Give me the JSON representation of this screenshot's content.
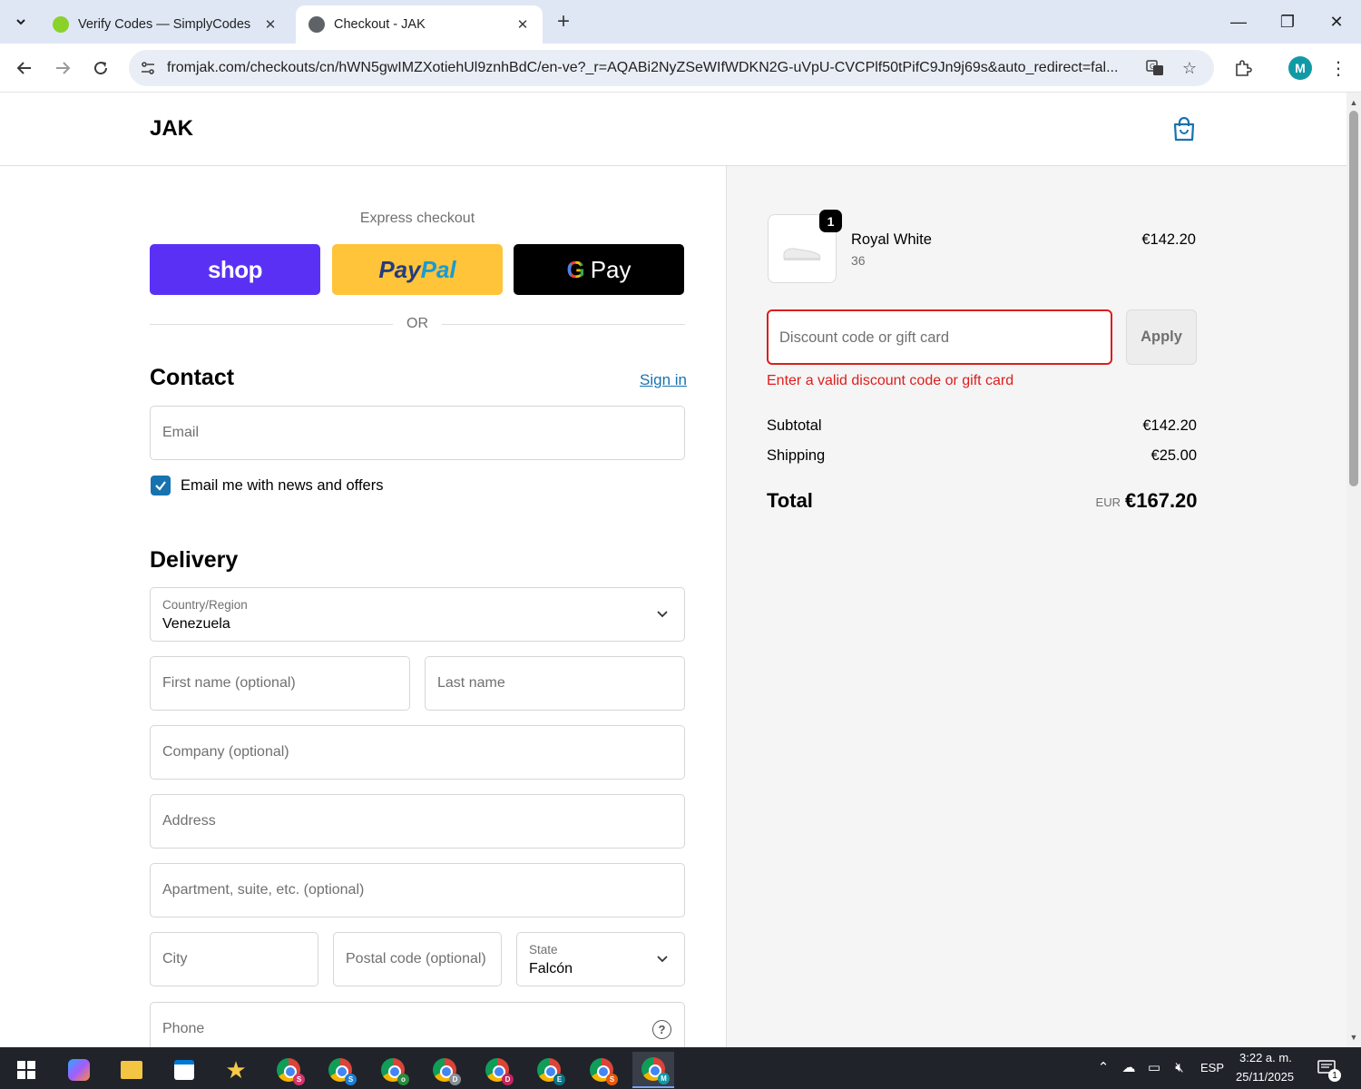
{
  "browser": {
    "tabs": [
      {
        "title": "Verify Codes — SimplyCodes",
        "active": false
      },
      {
        "title": "Checkout - JAK",
        "active": true
      }
    ],
    "url": "fromjak.com/checkouts/cn/hWN5gwIMZXotiehUl9znhBdC/en-ve?_r=AQABi2NyZSeWIfWDKN2G-uVpU-CVCPlf50tPifC9Jn9j69s&auto_redirect=fal...",
    "profile_initial": "M"
  },
  "header": {
    "logo": "JAK",
    "bag_icon": "shopping-bag-icon"
  },
  "express": {
    "title": "Express checkout",
    "shop_label": "shop",
    "paypal_label_1": "Pay",
    "paypal_label_2": "Pal",
    "gpay_g": "G",
    "gpay_label": "Pay",
    "or_label": "OR"
  },
  "contact": {
    "title": "Contact",
    "sign_in": "Sign in",
    "email_placeholder": "Email",
    "newsletter_label": "Email me with news and offers",
    "newsletter_checked": true
  },
  "delivery": {
    "title": "Delivery",
    "country_label": "Country/Region",
    "country_value": "Venezuela",
    "first_name_placeholder": "First name (optional)",
    "last_name_placeholder": "Last name",
    "company_placeholder": "Company (optional)",
    "address_placeholder": "Address",
    "apartment_placeholder": "Apartment, suite, etc. (optional)",
    "city_placeholder": "City",
    "postal_placeholder": "Postal code (optional)",
    "state_label": "State",
    "state_value": "Falcón",
    "phone_placeholder": "Phone",
    "phone_help": "?"
  },
  "order": {
    "product": {
      "name": "Royal White",
      "variant": "36",
      "quantity": "1",
      "price": "€142.20"
    },
    "discount_placeholder": "Discount code or gift card",
    "apply_label": "Apply",
    "discount_error": "Enter a valid discount code or gift card",
    "subtotal_label": "Subtotal",
    "subtotal_value": "€142.20",
    "shipping_label": "Shipping",
    "shipping_value": "€25.00",
    "total_label": "Total",
    "total_currency": "EUR",
    "total_value": "€167.20"
  },
  "taskbar": {
    "language": "ESP",
    "time": "3:22 a. m.",
    "date": "25/11/2025",
    "notification_count": "1",
    "chrome_profiles": [
      "S",
      "S",
      "o",
      "D",
      "D",
      "E",
      "S",
      "M"
    ]
  },
  "colors": {
    "accent": "#1773b0",
    "error": "#dd1d1d",
    "shop_pay": "#5a31f4",
    "paypal": "#ffc439"
  }
}
